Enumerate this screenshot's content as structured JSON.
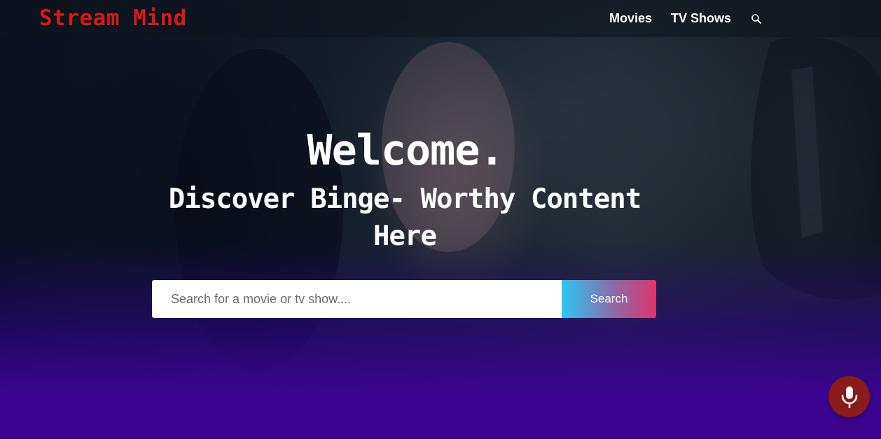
{
  "header": {
    "logo": "Stream Mind",
    "nav": [
      {
        "label": "Movies"
      },
      {
        "label": "TV Shows"
      }
    ],
    "search_icon": "search-icon"
  },
  "hero": {
    "welcome": "Welcome.",
    "subtitle": "Discover Binge- Worthy Content Here"
  },
  "search": {
    "placeholder": "Search for a movie or tv show....",
    "button_label": "Search"
  },
  "voice": {
    "icon": "microphone-icon"
  },
  "colors": {
    "logo": "#d51a1a",
    "mic_button": "#8b1a1a",
    "search_gradient_start": "#2ec6f5",
    "search_gradient_end": "#e0356e",
    "hero_bottom": "#3c048f"
  }
}
